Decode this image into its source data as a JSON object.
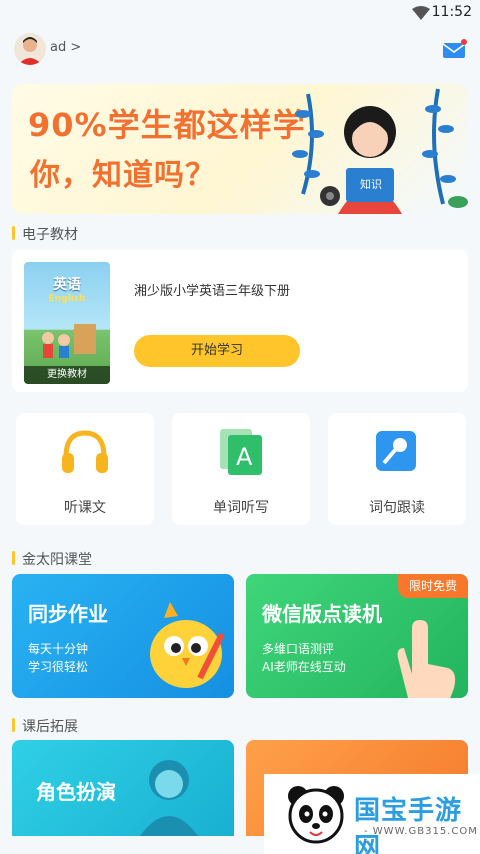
{
  "status_bar": {
    "time": "11:52"
  },
  "header": {
    "username": "ad >"
  },
  "banner": {
    "line1": "90%学生都这样学",
    "line2": "你，知道吗？",
    "book_tag": "知识"
  },
  "textbook": {
    "section_title": "电子教材",
    "cover_title": "英语",
    "cover_subtitle": "English",
    "change_label": "更换教材",
    "book_name": "湘少版小学英语三年级下册",
    "start_button": "开始学习"
  },
  "features": [
    {
      "label": "听课文",
      "icon": "headphones-icon"
    },
    {
      "label": "单词听写",
      "icon": "word-card-icon"
    },
    {
      "label": "词句跟读",
      "icon": "microphone-icon"
    }
  ],
  "classroom": {
    "section_title": "金太阳课堂",
    "cards": [
      {
        "title": "同步作业",
        "sub1": "每天十分钟",
        "sub2": "学习很轻松",
        "color": "#1aa0e8"
      },
      {
        "title": "微信版点读机",
        "sub1": "多维口语测评",
        "sub2": "AI老师在线互动",
        "badge": "限时免费",
        "color": "#2ec66a"
      }
    ]
  },
  "after_class": {
    "section_title": "课后拓展",
    "cards": [
      {
        "title": "角色扮演",
        "color": "#22c1dc"
      },
      {
        "title": "",
        "color": "#f7893a"
      }
    ]
  },
  "watermark": {
    "title": "国宝手游网",
    "url": "- WWW.GB315.COM -"
  },
  "colors": {
    "accent": "#ffc52a",
    "banner_text": "#f2712f",
    "badge": "#f7782a"
  }
}
